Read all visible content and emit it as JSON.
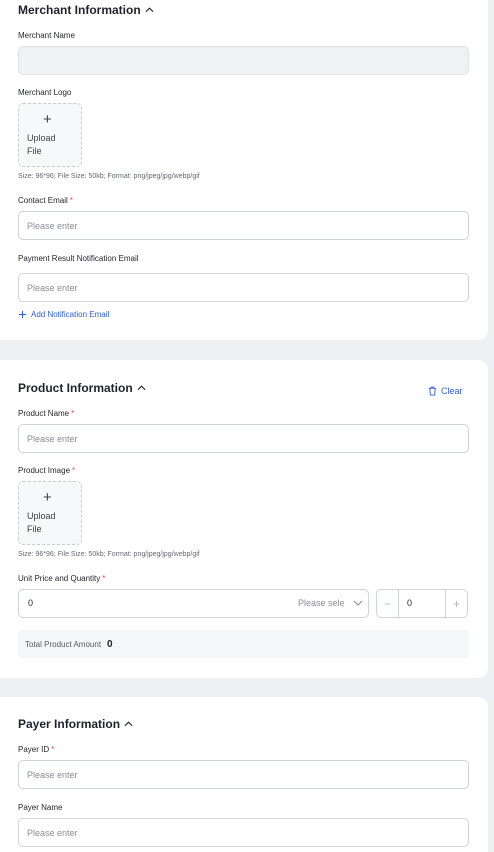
{
  "merchant": {
    "title": "Merchant Information",
    "name_label": "Merchant Name",
    "name_value": "",
    "logo_label": "Merchant Logo",
    "upload_line1": "Upload",
    "upload_line2": "File",
    "logo_hint": "Size: 96*96; File Size: 50kb; Format: png/jpeg/jpg/webp/gif",
    "email_label": "Contact Email",
    "email_placeholder": "Please enter",
    "notify_label": "Payment Result Notification Email",
    "notify_placeholder": "Please enter",
    "add_notify": "Add Notification Email"
  },
  "product": {
    "title": "Product Information",
    "clear": "Clear",
    "name_label": "Product Name",
    "name_placeholder": "Please enter",
    "image_label": "Product Image",
    "upload_line1": "Upload",
    "upload_line2": "File",
    "image_hint": "Size: 96*96; File Size: 50kb; Format: png/jpeg/jpg/webp/gif",
    "price_label": "Unit Price and Quantity",
    "price_value": "0",
    "currency_placeholder": "Please sele",
    "quantity_value": "0",
    "total_label": "Total Product Amount",
    "total_value": "0"
  },
  "payer": {
    "title": "Payer Information",
    "id_label": "Payer ID",
    "id_placeholder": "Please enter",
    "name_label": "Payer Name",
    "name_placeholder": "Please enter"
  },
  "colors": {
    "accent": "#2f5fd7",
    "required": "#e5484d",
    "background": "#eef0f3"
  }
}
